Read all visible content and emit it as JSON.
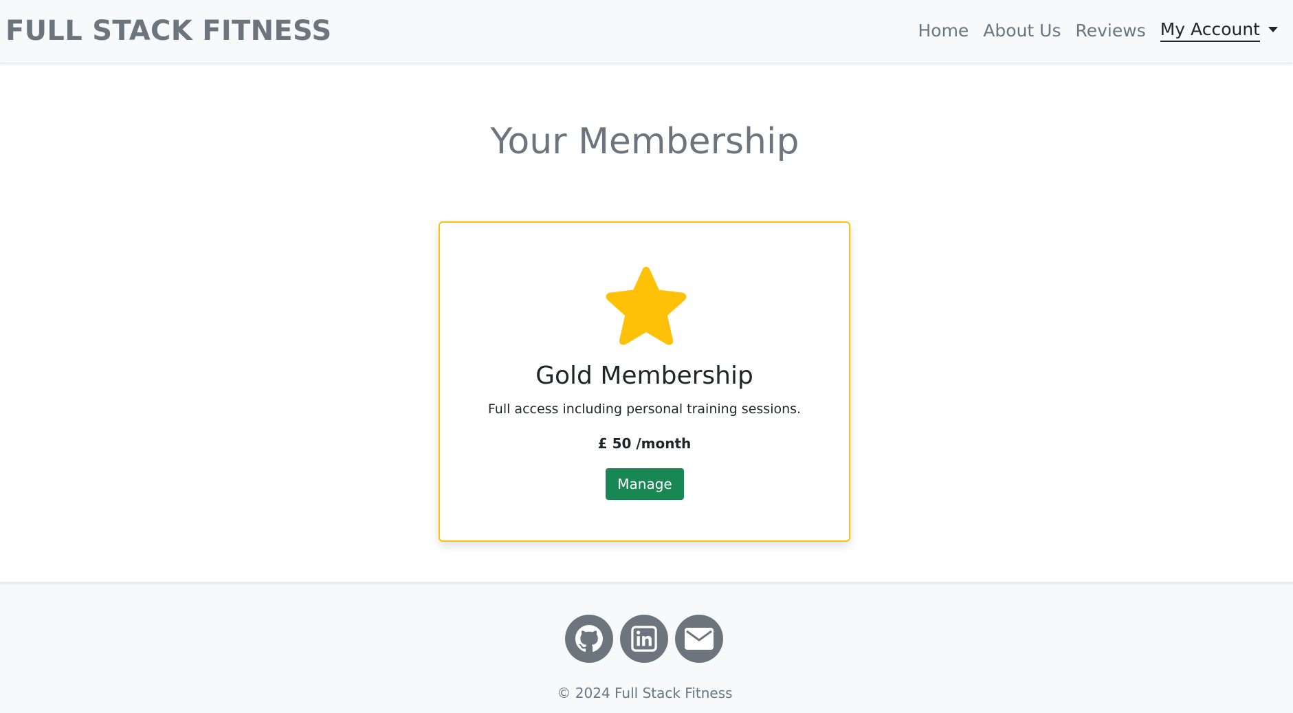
{
  "navbar": {
    "brand": "FULL STACK FITNESS",
    "links": {
      "home": "Home",
      "about": "About Us",
      "reviews": "Reviews",
      "account": "My Account"
    }
  },
  "main": {
    "title": "Your Membership",
    "membership_card": {
      "icon": "star-icon",
      "name": "Gold Membership",
      "description": "Full access including personal training sessions.",
      "price": "£ 50 /month",
      "button_label": "Manage"
    }
  },
  "footer": {
    "social": [
      "github-icon",
      "linkedin-icon",
      "envelope-icon"
    ],
    "copyright": "© 2024 Full Stack Fitness"
  },
  "colors": {
    "gold": "#ffc107",
    "success": "#198754",
    "muted": "#6c757d",
    "light": "#f8f9fa"
  }
}
